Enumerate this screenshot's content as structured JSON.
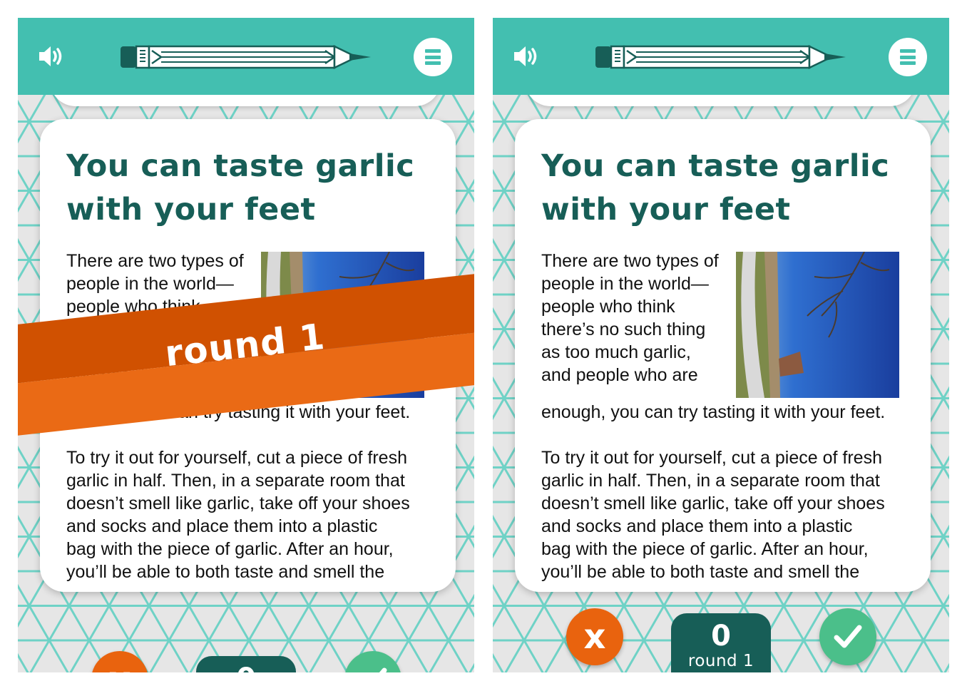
{
  "colors": {
    "teal": "#43bfb0",
    "dark_teal": "#175e57",
    "orange": "#e9630e",
    "dark_orange": "#d05101",
    "green": "#4bbf8a"
  },
  "icons": {
    "sound": "speaker-icon",
    "logo": "pencil-icon",
    "menu": "menu-icon",
    "wrong": "x-icon",
    "right": "check-icon"
  },
  "article": {
    "title_line1": "You can taste garlic",
    "title_line2": "with your feet",
    "para1_wrapped": "There are two types of\npeople in the world—\npeople who think\nthere’s no such thing\nas too much garlic,\nand people who are",
    "para1_tail": "enough, you can try tasting it with your feet.",
    "para2": "To try it out for yourself, cut a piece of fresh\ngarlic in half. Then, in a separate room that\ndoesn’t smell like garlic, take off your shoes\nand socks and place them into a plastic\nbag with the piece of garlic. After an hour,\nyou’ll be able to both taste and smell the"
  },
  "banner": {
    "label": "round 1"
  },
  "footer": {
    "x_label": "x",
    "score": "0",
    "round_label": "round 1"
  }
}
